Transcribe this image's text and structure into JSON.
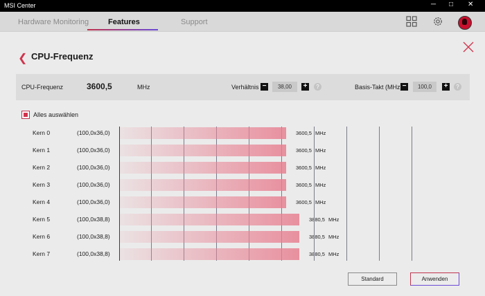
{
  "window": {
    "title": "MSI Center",
    "controls": [
      "─",
      "□",
      "✕"
    ]
  },
  "nav": {
    "tabs": [
      {
        "label": "Hardware Monitoring"
      },
      {
        "label": "Features"
      },
      {
        "label": "Support"
      }
    ],
    "active_tab": "Features",
    "icons": [
      "grid-icon",
      "gear-icon",
      "avatar-icon"
    ]
  },
  "page": {
    "title": "CPU-Frequenz",
    "back_icon": "chevron-left-icon",
    "close_icon": "close-icon"
  },
  "freq_bar": {
    "label": "CPU-Frequenz",
    "value": "3600,5",
    "unit": "MHz",
    "ratio": {
      "label": "Verhältnis",
      "minus": "−",
      "value": "38,00",
      "plus": "+",
      "help": "?"
    },
    "base": {
      "label": "Basis-Takt (MHz)",
      "minus": "−",
      "value": "100,0",
      "plus": "+",
      "help": "?"
    }
  },
  "select_all": {
    "label": "Alles auswählen",
    "checked": true
  },
  "cores": [
    {
      "name": "Kern 0",
      "ratio": "(100,0x36,0)",
      "value": "3600,5",
      "unit": "MHz",
      "fraction": 0.545
    },
    {
      "name": "Kern 1",
      "ratio": "(100,0x36,0)",
      "value": "3600,5",
      "unit": "MHz",
      "fraction": 0.545
    },
    {
      "name": "Kern 2",
      "ratio": "(100,0x36,0)",
      "value": "3600,5",
      "unit": "MHz",
      "fraction": 0.545
    },
    {
      "name": "Kern 3",
      "ratio": "(100,0x36,0)",
      "value": "3600,5",
      "unit": "MHz",
      "fraction": 0.545
    },
    {
      "name": "Kern 4",
      "ratio": "(100,0x36,0)",
      "value": "3600,5",
      "unit": "MHz",
      "fraction": 0.545
    },
    {
      "name": "Kern 5",
      "ratio": "(100,0x38,8)",
      "value": "3880,5",
      "unit": "MHz",
      "fraction": 0.588
    },
    {
      "name": "Kern 6",
      "ratio": "(100,0x38,8)",
      "value": "3880,5",
      "unit": "MHz",
      "fraction": 0.588
    },
    {
      "name": "Kern 7",
      "ratio": "(100,0x38,8)",
      "value": "3880,5",
      "unit": "MHz",
      "fraction": 0.588
    }
  ],
  "buttons": {
    "standard": "Standard",
    "apply": "Anwenden"
  },
  "colors": {
    "accent": "#d0344d",
    "accent2": "#6a4bd6"
  }
}
